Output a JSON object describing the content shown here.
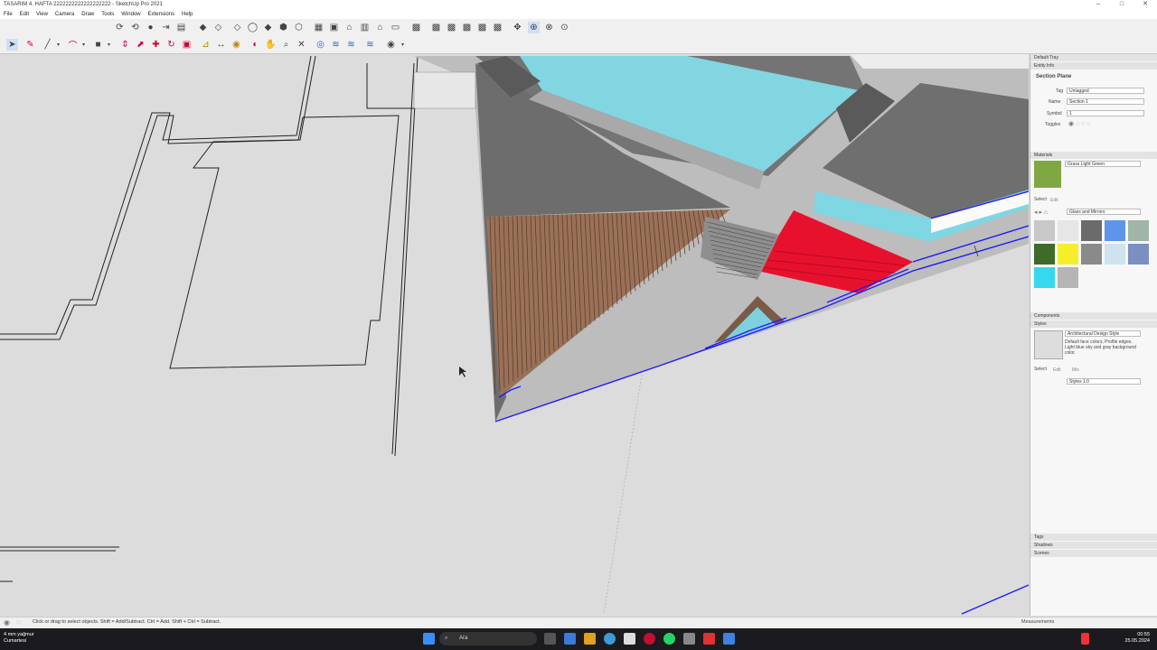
{
  "app": {
    "title": "TASARIM 4. HAFTA 2222222222222222222 - SketchUp Pro 2021",
    "minimize": "–",
    "maximize": "□",
    "close": "✕"
  },
  "menu": [
    "File",
    "Edit",
    "View",
    "Camera",
    "Draw",
    "Tools",
    "Window",
    "Extensions",
    "Help"
  ],
  "tray": {
    "title": "Default Tray",
    "entity_info": {
      "header": "Entity Info",
      "type": "Section Plane",
      "tag_label": "Tag",
      "tag_value": "Untagged",
      "name_label": "Name",
      "name_value": "Section 1",
      "symbol_label": "Symbol",
      "symbol_value": "1",
      "toggles_label": "Toggles"
    },
    "materials": {
      "header": "Materials",
      "current": "Grass Light Green",
      "tab_select": "Select",
      "tab_edit": "Edit",
      "library": "Glass and Mirrors",
      "swatch_colors": [
        "#c8c8c8",
        "#e6e6e6",
        "#6b6b6b",
        "#5f95e8",
        "#9fb5a8",
        "#3f6a2a",
        "#f5ee2a",
        "#8a8a8a",
        "#cfe3ee",
        "#7b90c0",
        "#34d9ee",
        "#b5b5b5"
      ]
    },
    "components": {
      "header": "Components"
    },
    "styles": {
      "header": "Styles",
      "name": "Architectural Design Style",
      "description": "Default face colors. Profile edges. Light blue sky and gray background color.",
      "tab_select": "Select",
      "tab_edit": "Edit",
      "tab_mix": "Mix",
      "collection": "Styles 1.0"
    },
    "collapsed": [
      "Tags",
      "Shadows",
      "Scenes"
    ]
  },
  "status": {
    "message": "Click or drag to select objects. Shift = Add/Subtract. Ctrl = Add. Shift + Ctrl = Subtract.",
    "measurements_label": "Measurements"
  },
  "taskbar": {
    "weather_temp": "4 mm yağmur",
    "weather_desc": "Cumartesi",
    "search_placeholder": "Ara",
    "time": "00:55",
    "date": "25.05.2024"
  },
  "colors": {
    "accent_red": "#e8112d",
    "accent_cyan": "#7fd8e6",
    "roof_brown": "#9b7258",
    "wall_gray": "#6e6e6e",
    "edge_blue": "#1b1bff"
  }
}
